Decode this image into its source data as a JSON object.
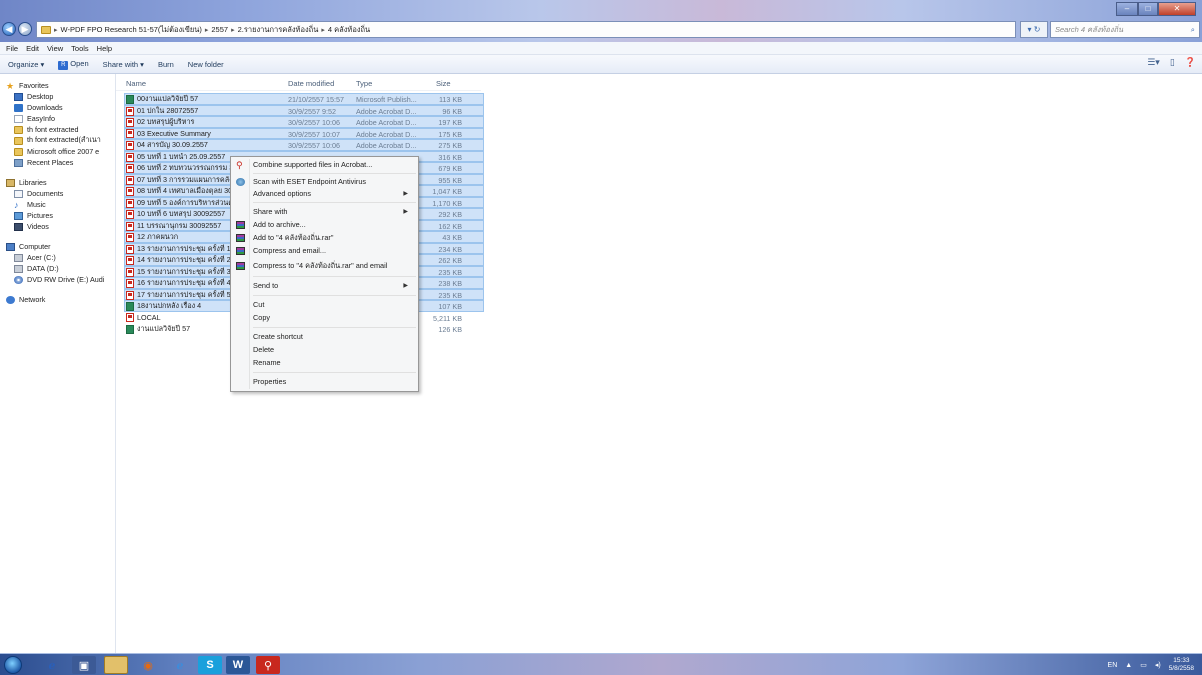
{
  "address": {
    "crumbs": [
      "W-PDF FPO Research 51-57(ไม่ต้องเขียน)",
      "2557",
      "2.รายงานการคลังท้องถิ่น",
      "4 คลังท้องถิ่น"
    ],
    "search_placeholder": "Search 4 คลังท้องถิ่น"
  },
  "menubar": [
    "File",
    "Edit",
    "View",
    "Tools",
    "Help"
  ],
  "toolbar": {
    "organize": "Organize ▾",
    "open": "Open",
    "share_with": "Share with ▾",
    "burn": "Burn",
    "new_folder": "New folder"
  },
  "nav": {
    "favorites": "Favorites",
    "fav_items": [
      "Desktop",
      "Downloads",
      "EasyInfo",
      "th font extracted",
      "th font extracted(สำเนา",
      "Microsoft office 2007 e",
      "Recent Places"
    ],
    "libraries": "Libraries",
    "lib_items": [
      "Documents",
      "Music",
      "Pictures",
      "Videos"
    ],
    "computer": "Computer",
    "comp_items": [
      "Acer (C:)",
      "DATA (D:)",
      "DVD RW Drive (E:) Audi"
    ],
    "network": "Network"
  },
  "columns": {
    "name": "Name",
    "date": "Date modified",
    "type": "Type",
    "size": "Size"
  },
  "files": [
    {
      "name": "00งานแปลวิจัยปี 57",
      "date": "21/10/2557 15:57",
      "type": "Microsoft Publish...",
      "size": "113 KB",
      "icon": "publisher",
      "selected": true
    },
    {
      "name": "01 ปกใน 28072557",
      "date": "30/9/2557 9:52",
      "type": "Adobe Acrobat D...",
      "size": "96 KB",
      "icon": "pdf",
      "selected": true
    },
    {
      "name": "02 บทสรุปผู้บริหาร",
      "date": "30/9/2557 10:06",
      "type": "Adobe Acrobat D...",
      "size": "197 KB",
      "icon": "pdf",
      "selected": true
    },
    {
      "name": "03 Executive Summary",
      "date": "30/9/2557 10:07",
      "type": "Adobe Acrobat D...",
      "size": "175 KB",
      "icon": "pdf",
      "selected": true
    },
    {
      "name": "04 สารบัญ 30.09.2557",
      "date": "30/9/2557 10:06",
      "type": "Adobe Acrobat D...",
      "size": "275 KB",
      "icon": "pdf",
      "selected": true
    },
    {
      "name": "05 บทที่ 1 บทนำ 25.09.2557",
      "date": "",
      "type": "...",
      "size": "316 KB",
      "icon": "pdf",
      "selected": true
    },
    {
      "name": "06 บทที่ 2 ทบทวนวรรณกรรม 3",
      "date": "",
      "type": "...",
      "size": "679 KB",
      "icon": "pdf",
      "selected": true
    },
    {
      "name": "07 บทที่ 3 การรวมแผนการคลัง",
      "date": "",
      "type": "...",
      "size": "955 KB",
      "icon": "pdf",
      "selected": true
    },
    {
      "name": "08 บทที่ 4 เทศบาลเมืองตุลย 30",
      "date": "",
      "type": "...",
      "size": "1,047 KB",
      "icon": "pdf",
      "selected": true
    },
    {
      "name": "09 บทที่ 5 องค์การบริหารส่วนต",
      "date": "",
      "type": "...",
      "size": "1,170 KB",
      "icon": "pdf",
      "selected": true
    },
    {
      "name": "10 บทที่ 6 บทสรุป 30092557",
      "date": "",
      "type": "...",
      "size": "292 KB",
      "icon": "pdf",
      "selected": true
    },
    {
      "name": "11 บรรณานุกรม 30092557",
      "date": "",
      "type": "...",
      "size": "162 KB",
      "icon": "pdf",
      "selected": true
    },
    {
      "name": "12 ภาคผนวก",
      "date": "",
      "type": "...",
      "size": "43 KB",
      "icon": "pdf",
      "selected": true
    },
    {
      "name": "13 รายงานการประชุม ครั้งที่ 1",
      "date": "",
      "type": "...",
      "size": "234 KB",
      "icon": "pdf",
      "selected": true
    },
    {
      "name": "14 รายงานการประชุม ครั้งที่ 2",
      "date": "",
      "type": "...",
      "size": "262 KB",
      "icon": "pdf",
      "selected": true
    },
    {
      "name": "15 รายงานการประชุม ครั้งที่ 3",
      "date": "",
      "type": "...",
      "size": "235 KB",
      "icon": "pdf",
      "selected": true
    },
    {
      "name": "16 รายงานการประชุม ครั้งที่ 4",
      "date": "",
      "type": "...",
      "size": "238 KB",
      "icon": "pdf",
      "selected": true
    },
    {
      "name": "17 รายงานการประชุม ครั้งที่ 5",
      "date": "",
      "type": "...",
      "size": "235 KB",
      "icon": "pdf",
      "selected": true
    },
    {
      "name": "18งานปกหลัง เรื่อง 4",
      "date": "",
      "type": "...",
      "size": "107 KB",
      "icon": "publisher",
      "selected": true
    },
    {
      "name": "LOCAL",
      "date": "",
      "type": "...",
      "size": "5,211 KB",
      "icon": "pdf",
      "selected": false
    },
    {
      "name": "งานแปลวิจัยปี 57",
      "date": "",
      "type": "...",
      "size": "126 KB",
      "icon": "publisher",
      "selected": false
    }
  ],
  "context_menu": {
    "combine": "Combine supported files in Acrobat...",
    "scan": "Scan with ESET Endpoint Antivirus",
    "advanced": "Advanced options",
    "share_with": "Share with",
    "add_archive": "Add to archive...",
    "add_rar": "Add to \"4 คลังท้องถิ่น.rar\"",
    "compress_email": "Compress and email...",
    "compress_rar_email": "Compress to \"4 คลังท้องถิ่น.rar\" and email",
    "send_to": "Send to",
    "cut": "Cut",
    "copy": "Copy",
    "create_shortcut": "Create shortcut",
    "delete": "Delete",
    "rename": "Rename",
    "properties": "Properties"
  },
  "tray": {
    "lang": "EN",
    "time": "15:33",
    "date": "5/8/2558"
  },
  "colors": {
    "selection": "#cfe2f8",
    "accent": "#2d6bd0"
  }
}
